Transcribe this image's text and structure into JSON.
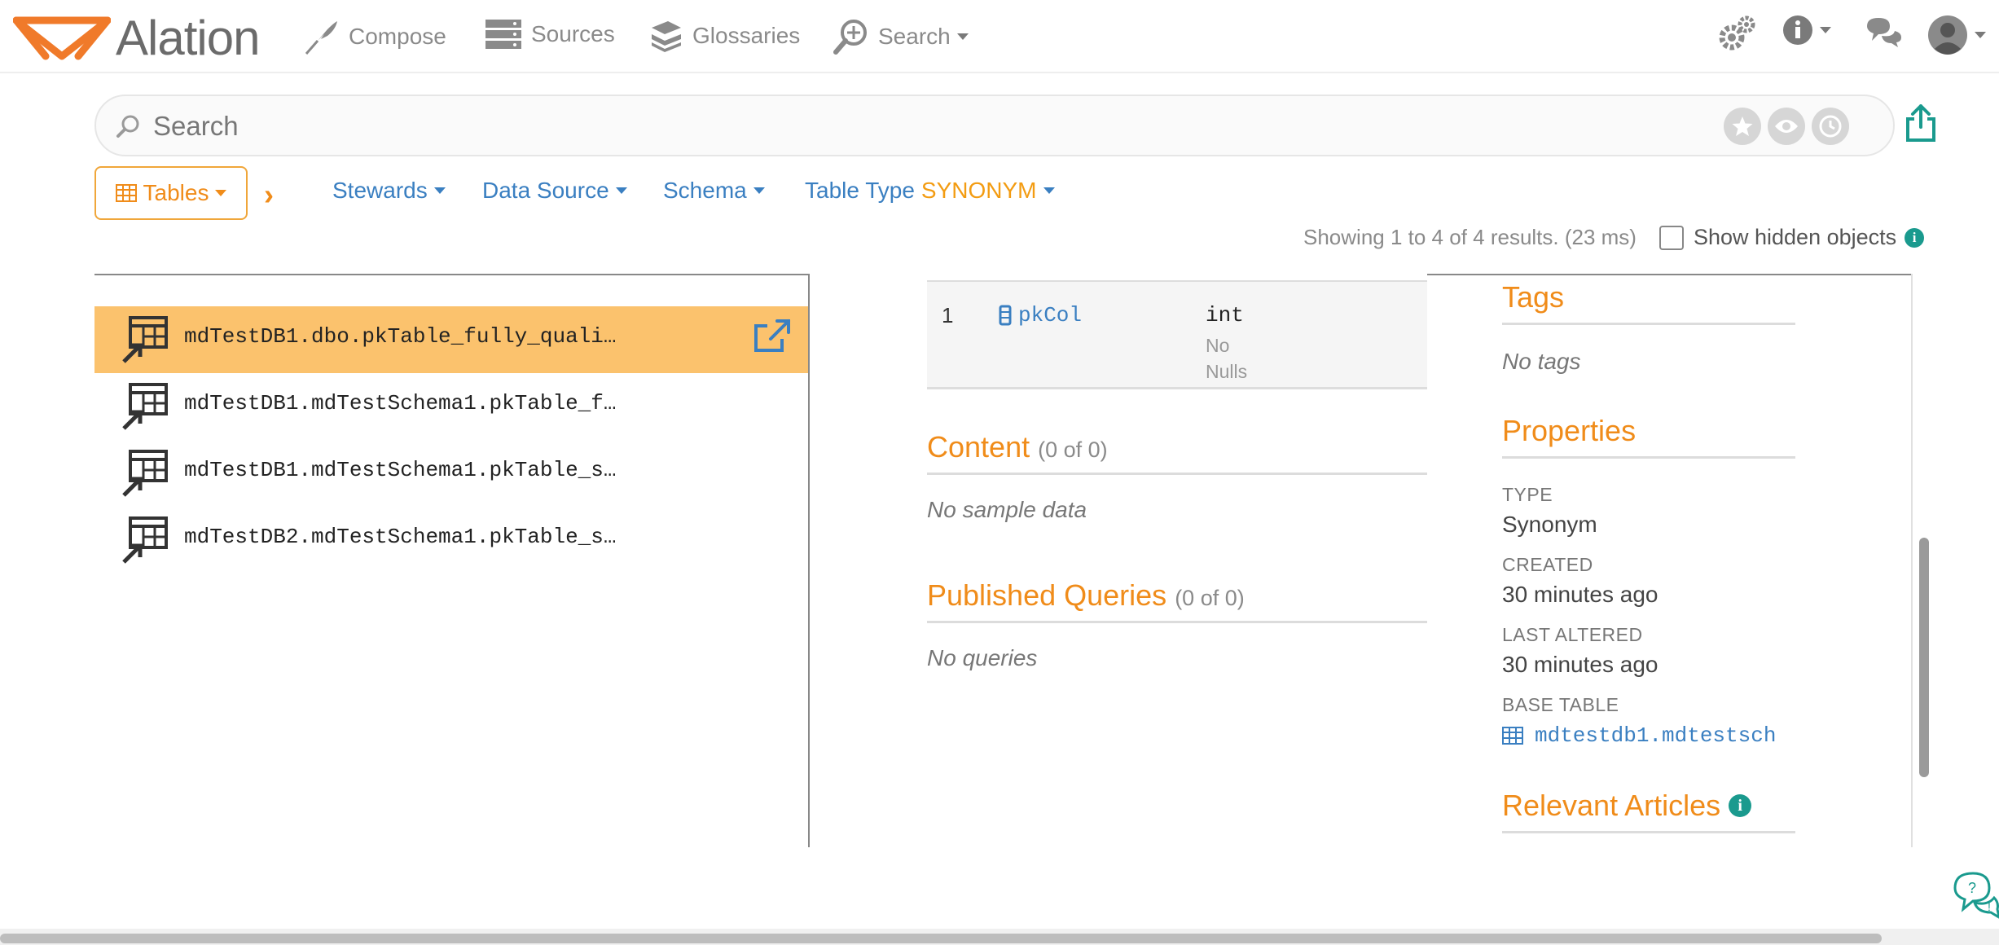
{
  "app": {
    "logo_text": "Alation"
  },
  "nav": {
    "compose": "Compose",
    "sources": "Sources",
    "glossaries": "Glossaries",
    "search": "Search"
  },
  "search": {
    "placeholder": "Search"
  },
  "filters": {
    "object_type": "Tables",
    "stewards": "Stewards",
    "data_source": "Data Source",
    "schema": "Schema",
    "table_type_label": "Table Type",
    "table_type_value": "SYNONYM"
  },
  "results": {
    "summary": "Showing 1 to 4 of 4 results. (23 ms)",
    "show_hidden_label": "Show hidden objects"
  },
  "list": {
    "items": [
      {
        "name": "mdTestDB1.dbo.pkTable_fully_quali…",
        "selected": true
      },
      {
        "name": "mdTestDB1.mdTestSchema1.pkTable_f…",
        "selected": false
      },
      {
        "name": "mdTestDB1.mdTestSchema1.pkTable_s…",
        "selected": false
      },
      {
        "name": "mdTestDB2.mdTestSchema1.pkTable_s…",
        "selected": false
      }
    ]
  },
  "columns": {
    "rows": [
      {
        "num": "1",
        "name": "pkCol",
        "type": "int",
        "nullable_line1": "No",
        "nullable_line2": "Nulls"
      }
    ]
  },
  "content": {
    "title": "Content",
    "count": "(0 of 0)",
    "empty": "No sample data"
  },
  "published_queries": {
    "title": "Published Queries",
    "count": "(0 of 0)",
    "empty": "No queries"
  },
  "tags": {
    "title": "Tags",
    "empty": "No tags"
  },
  "properties": {
    "title": "Properties",
    "type_label": "TYPE",
    "type_value": "Synonym",
    "created_label": "CREATED",
    "created_value": "30 minutes ago",
    "altered_label": "LAST ALTERED",
    "altered_value": "30 minutes ago",
    "base_table_label": "BASE TABLE",
    "base_table_value": "mdtestdb1.mdtestsch"
  },
  "relevant_articles": {
    "title": "Relevant Articles"
  },
  "colors": {
    "accent_orange": "#f08c1a",
    "link_blue": "#3a7fc1",
    "selected_row": "#fbc26d",
    "info_teal": "#1a9a8e"
  }
}
